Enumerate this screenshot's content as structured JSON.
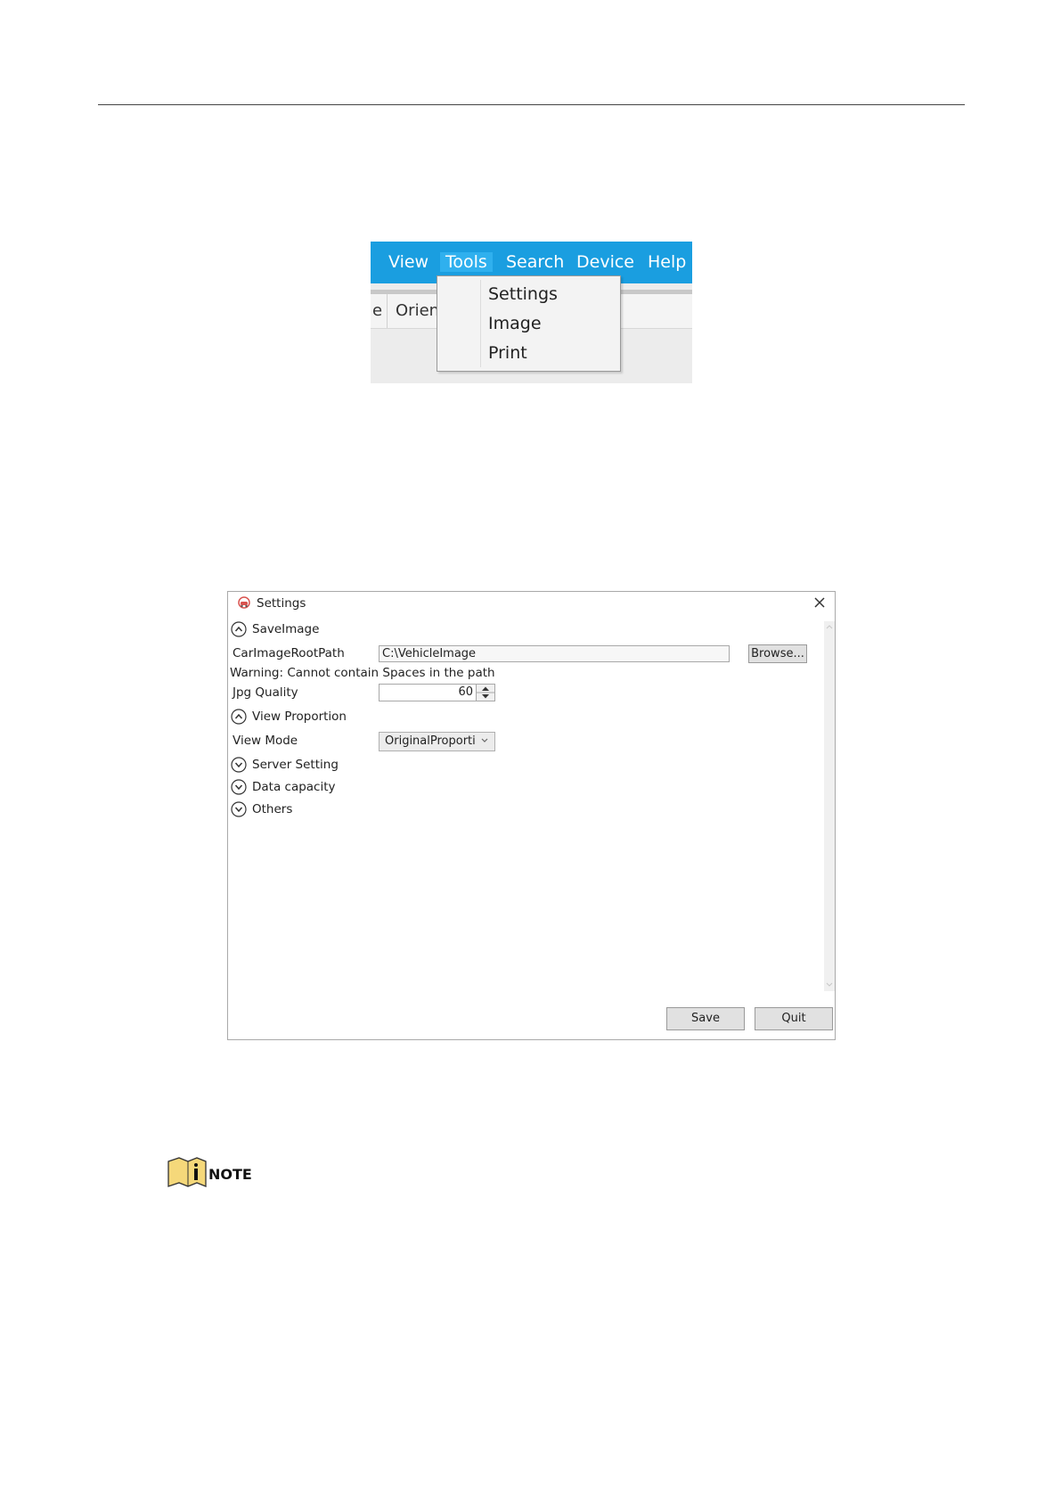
{
  "menu_figure": {
    "menu_bar": [
      "View",
      "Tools",
      "Search",
      "Device",
      "Help"
    ],
    "active_menu": "Tools",
    "toolbar_fragments": [
      "e",
      "Orien"
    ],
    "dropdown_items": [
      "Settings",
      "Image",
      "Print"
    ],
    "accent_color": "#1a9ee0"
  },
  "settings_dialog": {
    "title": "Settings",
    "sections": {
      "save_image": "SaveImage",
      "view_proportion": "View Proportion",
      "server_setting": "Server Setting",
      "data_capacity": "Data capacity",
      "others": "Others"
    },
    "fields": {
      "car_image_root_path_label": "CarImageRootPath",
      "car_image_root_path_value": "C:\\VehicleImage",
      "browse_label": "Browse...",
      "warning": "Warning: Cannot contain Spaces in the path",
      "jpg_quality_label": "Jpg Quality",
      "jpg_quality_value": "60",
      "view_mode_label": "View Mode",
      "view_mode_value": "OriginalProporti"
    },
    "buttons": {
      "save": "Save",
      "quit": "Quit"
    }
  },
  "note": {
    "label": "NOTE"
  }
}
